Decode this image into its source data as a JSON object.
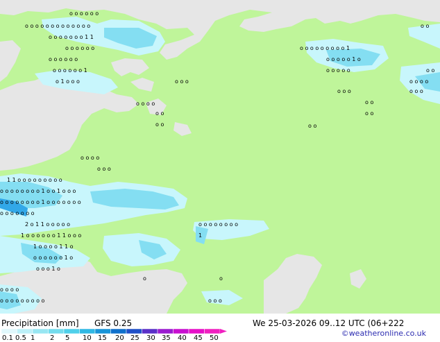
{
  "title": "Precipitation [mm]",
  "model": "GFS 0.25",
  "valid_time": "We 25-03-2026 09..12 UTC (06+222",
  "credit": "©weatheronline.co.uk",
  "legend": {
    "labels": [
      "0.1",
      "0.5",
      "1",
      "2",
      "5",
      "10",
      "15",
      "20",
      "25",
      "30",
      "35",
      "40",
      "45",
      "50"
    ],
    "colors": [
      "#e0f8fc",
      "#bcf0f8",
      "#98e6f2",
      "#74dced",
      "#50d0ea",
      "#30b8e4",
      "#1894d8",
      "#1070cc",
      "#2050c8",
      "#5a30c8",
      "#9a1cd0",
      "#c810d0",
      "#e610c8",
      "#f020c0"
    ]
  },
  "colors": {
    "land": "#bff59a",
    "sea": "#e6e6e6",
    "precip_light": "#c8f6fc",
    "precip_medium": "#84def2",
    "precip_heavy": "#32a8e8"
  }
}
